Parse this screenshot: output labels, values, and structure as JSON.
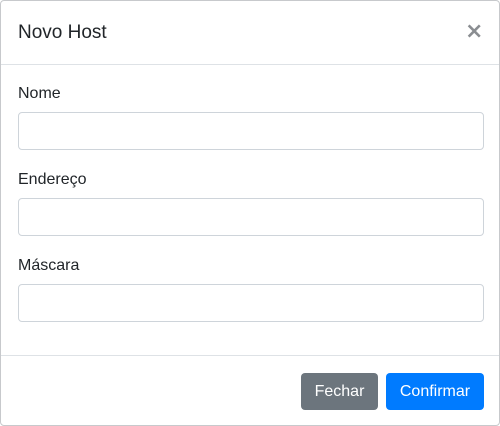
{
  "modal": {
    "title": "Novo Host",
    "close_symbol": "×"
  },
  "form": {
    "fields": [
      {
        "label": "Nome",
        "value": "",
        "placeholder": ""
      },
      {
        "label": "Endereço",
        "value": "",
        "placeholder": ""
      },
      {
        "label": "Máscara",
        "value": "",
        "placeholder": ""
      }
    ]
  },
  "footer": {
    "close_label": "Fechar",
    "confirm_label": "Confirmar"
  },
  "colors": {
    "primary": "#007bff",
    "secondary": "#6c757d"
  },
  "icons": {
    "close": "close-icon"
  }
}
